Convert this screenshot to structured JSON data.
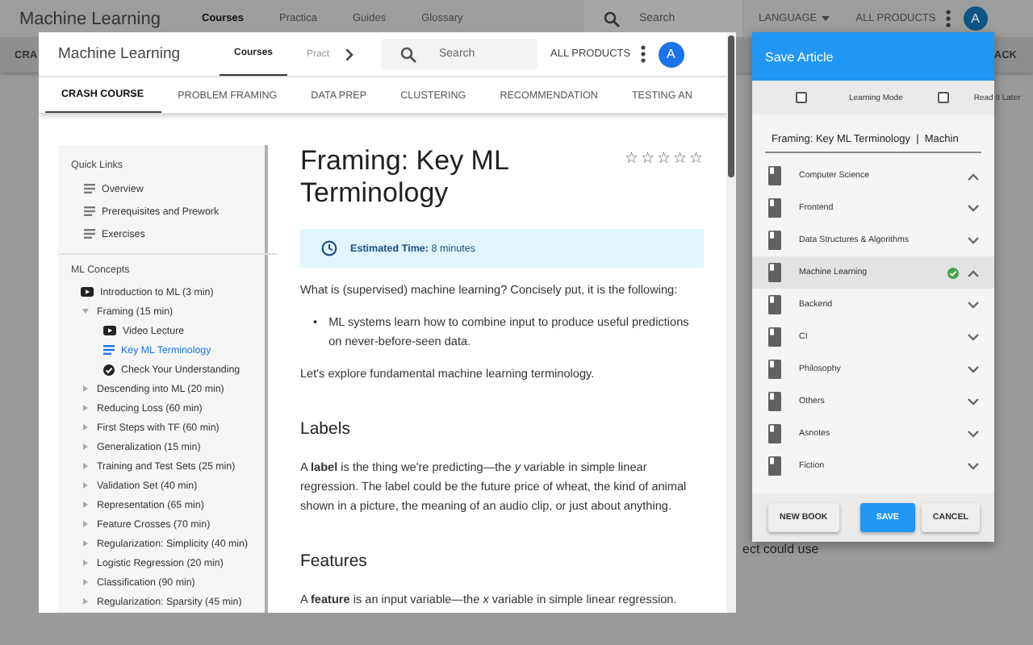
{
  "background_page": {
    "logo": "Machine Learning",
    "nav": [
      {
        "label": "Courses",
        "selected": true
      },
      {
        "label": "Practica",
        "selected": false
      },
      {
        "label": "Guides",
        "selected": false
      },
      {
        "label": "Glossary",
        "selected": false
      }
    ],
    "search": {
      "placeholder": "Search"
    },
    "language": "LANGUAGE",
    "all_products": "ALL PRODUCTS",
    "avatar": "A",
    "subnav_left": "CRA",
    "subnav_right": "ACK",
    "fragment_text": "ect could use"
  },
  "site_window": {
    "logo": "Machine Learning",
    "nav": [
      {
        "label": "Courses",
        "selected": true
      },
      {
        "label": "Pract",
        "selected": false
      }
    ],
    "search": {
      "placeholder": "Search"
    },
    "all_products": "ALL PRODUCTS",
    "avatar": "A",
    "tabs": [
      {
        "label": "CRASH COURSE",
        "selected": true
      },
      {
        "label": "PROBLEM FRAMING",
        "selected": false
      },
      {
        "label": "DATA PREP",
        "selected": false
      },
      {
        "label": "CLUSTERING",
        "selected": false
      },
      {
        "label": "RECOMMENDATION",
        "selected": false
      },
      {
        "label": "TESTING AN",
        "selected": false
      }
    ],
    "sidebar": {
      "sections": [
        {
          "title": "Quick Links",
          "items": [
            {
              "label": "Overview",
              "kind": "page",
              "selected": false
            },
            {
              "label": "Prerequisites and Prework",
              "kind": "page",
              "selected": false
            },
            {
              "label": "Exercises",
              "kind": "page",
              "selected": false
            }
          ]
        },
        {
          "title": "ML Concepts",
          "items": [
            {
              "label": "Introduction to ML (3 min)",
              "kind": "video",
              "selected": false
            },
            {
              "label": "Framing (15 min)",
              "kind": "folder",
              "expanded": true,
              "selected": false,
              "children": [
                {
                  "label": "Video Lecture",
                  "kind": "video",
                  "selected": false
                },
                {
                  "label": "Key ML Terminology",
                  "kind": "page",
                  "selected": true
                },
                {
                  "label": "Check Your Understanding",
                  "kind": "check",
                  "selected": false
                }
              ]
            },
            {
              "label": "Descending into ML (20 min)",
              "kind": "folder",
              "expanded": false,
              "selected": false
            },
            {
              "label": "Reducing Loss (60 min)",
              "kind": "folder",
              "expanded": false,
              "selected": false
            },
            {
              "label": "First Steps with TF (60 min)",
              "kind": "folder",
              "expanded": false,
              "selected": false
            },
            {
              "label": "Generalization (15 min)",
              "kind": "folder",
              "expanded": false,
              "selected": false
            },
            {
              "label": "Training and Test Sets (25 min)",
              "kind": "folder",
              "expanded": false,
              "selected": false
            },
            {
              "label": "Validation Set (40 min)",
              "kind": "folder",
              "expanded": false,
              "selected": false
            },
            {
              "label": "Representation (65 min)",
              "kind": "folder",
              "expanded": false,
              "selected": false
            },
            {
              "label": "Feature Crosses (70 min)",
              "kind": "folder",
              "expanded": false,
              "selected": false
            },
            {
              "label": "Regularization: Simplicity (40 min)",
              "kind": "folder",
              "expanded": false,
              "selected": false
            },
            {
              "label": "Logistic Regression (20 min)",
              "kind": "folder",
              "expanded": false,
              "selected": false
            },
            {
              "label": "Classification (90 min)",
              "kind": "folder",
              "expanded": false,
              "selected": false
            },
            {
              "label": "Regularization: Sparsity (45 min)",
              "kind": "folder",
              "expanded": false,
              "selected": false
            }
          ]
        }
      ]
    },
    "article": {
      "title": "Framing: Key ML Terminology",
      "stars": 0,
      "estimate": "**Estimated Time:** 8 minutes",
      "blocks": [
        {
          "kind": "paragraph",
          "text": "What is (supervised) machine learning? Concisely put, it is the following:"
        },
        {
          "kind": "bullet",
          "marker": "•",
          "text": "ML systems learn how to combine input to produce useful predictions on never-before-seen data."
        },
        {
          "kind": "paragraph",
          "text": "Let's explore fundamental machine learning terminology."
        },
        {
          "kind": "heading",
          "text": "Labels"
        },
        {
          "kind": "paragraph",
          "text": "A **label** is the thing we're predicting—the *y* variable in simple linear regression. The label could be the future price of wheat, the kind of animal shown in a picture, the meaning of an audio clip, or just about anything."
        },
        {
          "kind": "heading",
          "text": "Features"
        },
        {
          "kind": "paragraph",
          "text": "A **feature** is an input variable—the *x* variable in simple linear regression."
        }
      ]
    }
  },
  "save_panel": {
    "title": "Save Article",
    "options": [
      {
        "label": "Learning Mode",
        "checked": false
      },
      {
        "label": "Read It Later",
        "checked": false
      }
    ],
    "name_field": {
      "value": "Framing: Key ML Terminology  |  Machin"
    },
    "books": [
      {
        "label": "Computer Science",
        "expanded": true,
        "saved": false,
        "selected": false
      },
      {
        "label": "Frontend",
        "expanded": false,
        "saved": false,
        "selected": false
      },
      {
        "label": "Data Structures & Algorithms",
        "expanded": false,
        "saved": false,
        "selected": false
      },
      {
        "label": "Machine Learning",
        "expanded": true,
        "saved": true,
        "selected": true
      },
      {
        "label": "Backend",
        "expanded": false,
        "saved": false,
        "selected": false
      },
      {
        "label": "CI",
        "expanded": false,
        "saved": false,
        "selected": false
      },
      {
        "label": "Philosophy",
        "expanded": false,
        "saved": false,
        "selected": false
      },
      {
        "label": "Others",
        "expanded": false,
        "saved": false,
        "selected": false
      },
      {
        "label": "Asnotes",
        "expanded": false,
        "saved": false,
        "selected": false
      },
      {
        "label": "Fiction",
        "expanded": false,
        "saved": false,
        "selected": false
      }
    ],
    "buttons": [
      {
        "label": "NEW BOOK",
        "kind": "secondary"
      },
      {
        "label": "SAVE",
        "kind": "primary"
      },
      {
        "label": "CANCEL",
        "kind": "secondary"
      }
    ]
  }
}
